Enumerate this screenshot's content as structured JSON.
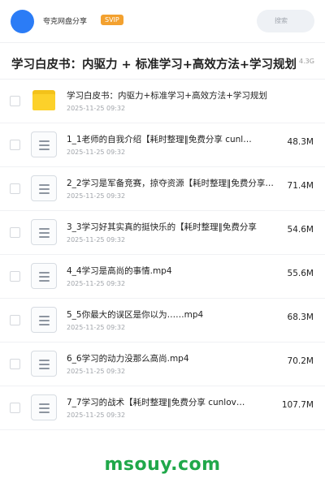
{
  "header": {
    "user_name": "夸克网盘分享",
    "badge": "SVIP",
    "search_placeholder": "搜索",
    "avatar_color": "#2b7cf6"
  },
  "folder": {
    "title": "学习白皮书：内驱力 + 标准学习+高效方法+学习规划",
    "total_size": "4.3G"
  },
  "items": [
    {
      "type": "folder",
      "icon": "folder-icon",
      "name": "学习白皮书：内驱力+标准学习+高效方法+学习规划",
      "date": "2025-11-25 09:32",
      "size": ""
    },
    {
      "type": "file",
      "icon": "document-icon",
      "name": "1_1老师的自我介绍【耗时整理‖免费分享 cunl…",
      "date": "2025-11-25 09:32",
      "size": "48.3M"
    },
    {
      "type": "file",
      "icon": "document-icon",
      "name": "2_2学习是军备竞赛，掠夺资源【耗时整理‖免费分享…",
      "date": "2025-11-25 09:32",
      "size": "71.4M"
    },
    {
      "type": "file",
      "icon": "document-icon",
      "name": "3_3学习好其实真的挺快乐的【耗时整理‖免费分享",
      "date": "2025-11-25 09:32",
      "size": "54.6M"
    },
    {
      "type": "file",
      "icon": "document-icon",
      "name": "4_4学习是高尚的事情.mp4",
      "date": "2025-11-25 09:32",
      "size": "55.6M"
    },
    {
      "type": "file",
      "icon": "document-icon",
      "name": "5_5你最大的误区是你以为……mp4",
      "date": "2025-11-25 09:32",
      "size": "68.3M"
    },
    {
      "type": "file",
      "icon": "document-icon",
      "name": "6_6学习的动力没那么高尚.mp4",
      "date": "2025-11-25 09:32",
      "size": "70.2M"
    },
    {
      "type": "file",
      "icon": "document-icon",
      "name": "7_7学习的战术【耗时整理‖免费分享 cunlov…",
      "date": "2025-11-25 09:32",
      "size": "107.7M"
    }
  ],
  "watermark": "msouy.com",
  "colors": {
    "accent": "#2b7cf6",
    "svip": "#f3a12f",
    "watermark": "#20a84a",
    "folder": "#fcd12a"
  }
}
